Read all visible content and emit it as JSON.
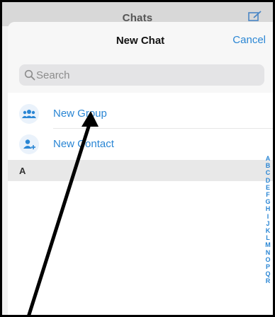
{
  "background": {
    "title": "Chats",
    "compose_icon": "compose-icon"
  },
  "sheet": {
    "title": "New Chat",
    "cancel_label": "Cancel",
    "search": {
      "placeholder": "Search",
      "value": ""
    },
    "actions": [
      {
        "label": "New Group",
        "icon": "group-icon"
      },
      {
        "label": "New Contact",
        "icon": "add-contact-icon"
      }
    ],
    "section_letter": "A",
    "alphabet_index": [
      "A",
      "B",
      "C",
      "D",
      "E",
      "F",
      "G",
      "H",
      "I",
      "J",
      "K",
      "L",
      "M",
      "N",
      "O",
      "P",
      "Q",
      "R"
    ]
  },
  "colors": {
    "accent": "#2a86d4",
    "section_bg": "#e8e8e8",
    "search_bg": "#e4e4e6"
  }
}
